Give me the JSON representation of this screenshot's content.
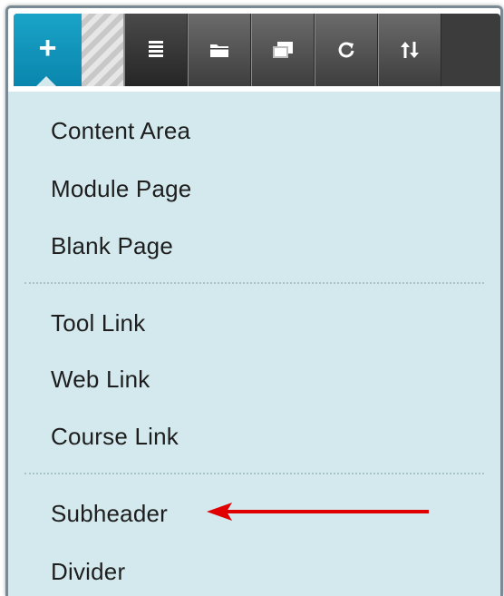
{
  "toolbar": {
    "add_icon": "plus-icon",
    "buttons": [
      {
        "icon": "list-icon"
      },
      {
        "icon": "folder-icon"
      },
      {
        "icon": "windows-icon"
      },
      {
        "icon": "refresh-icon"
      },
      {
        "icon": "sort-icon"
      }
    ],
    "add_symbol": "+"
  },
  "menu": {
    "group1": [
      "Content Area",
      "Module Page",
      "Blank Page"
    ],
    "group2": [
      "Tool Link",
      "Web Link",
      "Course Link"
    ],
    "group3": [
      "Subheader",
      "Divider"
    ]
  },
  "colors": {
    "accent": "#0a86ad",
    "menu_bg": "#d3e9ee",
    "arrow": "#e00000"
  }
}
